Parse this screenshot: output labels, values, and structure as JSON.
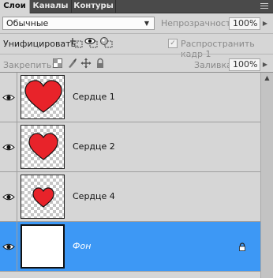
{
  "tabs": [
    {
      "label": "Слои"
    },
    {
      "label": "Каналы"
    },
    {
      "label": "Контуры"
    }
  ],
  "blend_mode": {
    "value": "Обычные"
  },
  "opacity": {
    "label": "Непрозрачность:",
    "value": "100%"
  },
  "unify": {
    "label": "Унифицировать:",
    "icons": [
      "unify-position-icon",
      "unify-visibility-icon",
      "unify-style-icon"
    ],
    "propagate_label": "Распространить кадр 1",
    "propagate_checked": true
  },
  "lock": {
    "label": "Закрепить:",
    "icons": [
      "lock-transparency-icon",
      "lock-pixels-icon",
      "lock-position-icon",
      "lock-all-icon"
    ]
  },
  "fill": {
    "label": "Заливка:",
    "value": "100%"
  },
  "layers": [
    {
      "name": "Сердце 1",
      "visible": true,
      "selected": false
    },
    {
      "name": "Сердце 2",
      "visible": true,
      "selected": false
    },
    {
      "name": "Сердце 4",
      "visible": true,
      "selected": false
    },
    {
      "name": "Фон",
      "visible": true,
      "selected": true,
      "locked": true
    }
  ],
  "colors": {
    "heart": "#e8232a",
    "selection": "#3d98f5",
    "tab_bar": "#4a4a4a",
    "panel": "#d6d6d6"
  }
}
